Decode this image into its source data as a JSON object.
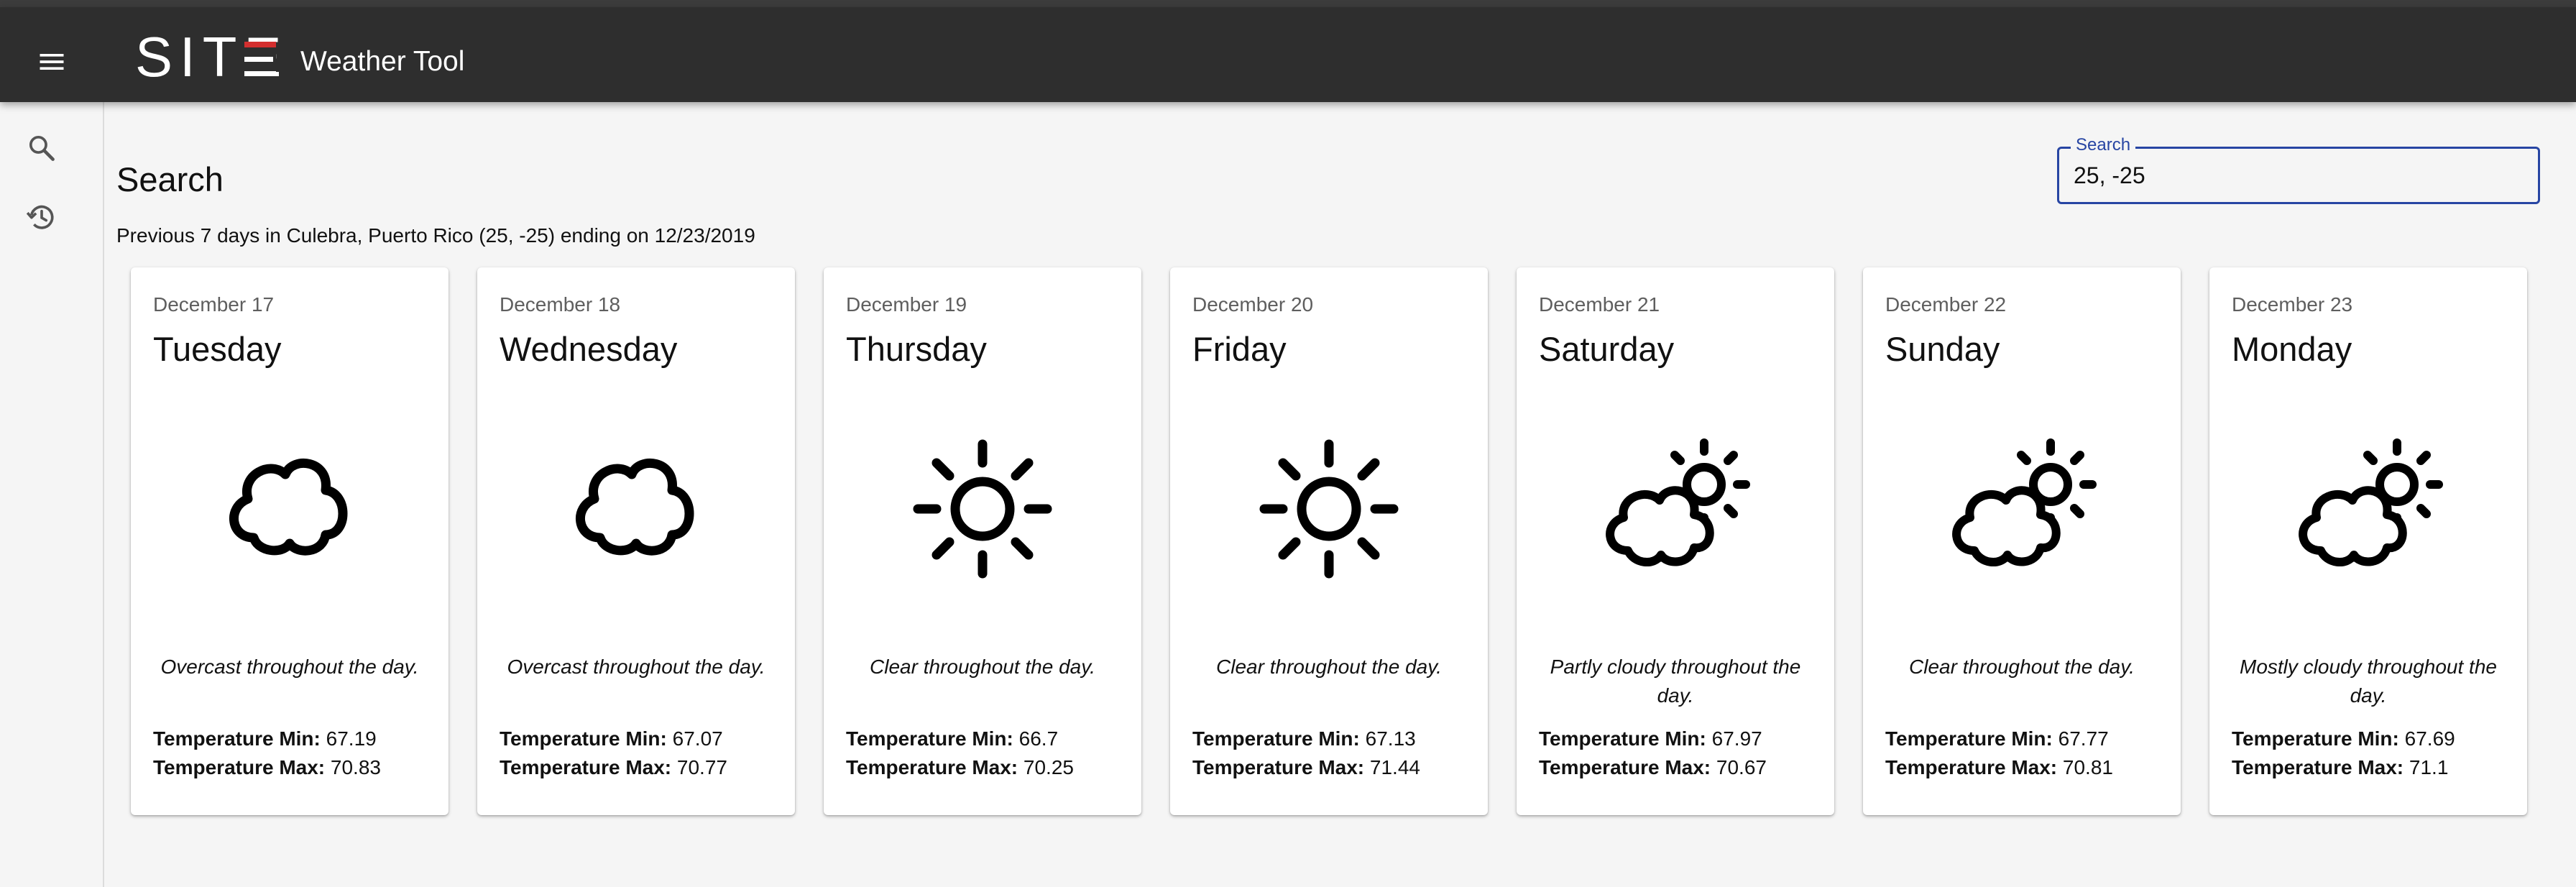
{
  "app": {
    "logo_text": "SITE",
    "title": "Weather Tool"
  },
  "sidebar": {
    "items": [
      {
        "icon": "search-icon"
      },
      {
        "icon": "history-icon"
      }
    ]
  },
  "main": {
    "heading": "Search",
    "subtitle": "Previous 7 days in Culebra, Puerto Rico (25, -25) ending on 12/23/2019"
  },
  "search": {
    "label": "Search",
    "value": "25, -25"
  },
  "temp_labels": {
    "min": "Temperature Min:",
    "max": "Temperature Max:"
  },
  "colors": {
    "appbar": "#2e2e2e",
    "accent": "#2745a3",
    "logo_red": "#d32f2f",
    "background": "#f5f5f5"
  },
  "days": [
    {
      "date": "December 17",
      "weekday": "Tuesday",
      "icon": "cloud-icon",
      "summary": "Overcast throughout the day.",
      "temp_min": "67.19",
      "temp_max": "70.83"
    },
    {
      "date": "December 18",
      "weekday": "Wednesday",
      "icon": "cloud-icon",
      "summary": "Overcast throughout the day.",
      "temp_min": "67.07",
      "temp_max": "70.77"
    },
    {
      "date": "December 19",
      "weekday": "Thursday",
      "icon": "sun-icon",
      "summary": "Clear throughout the day.",
      "temp_min": "66.7",
      "temp_max": "70.25"
    },
    {
      "date": "December 20",
      "weekday": "Friday",
      "icon": "sun-icon",
      "summary": "Clear throughout the day.",
      "temp_min": "67.13",
      "temp_max": "71.44"
    },
    {
      "date": "December 21",
      "weekday": "Saturday",
      "icon": "partly-cloudy-icon",
      "summary": "Partly cloudy throughout the day.",
      "temp_min": "67.97",
      "temp_max": "70.67"
    },
    {
      "date": "December 22",
      "weekday": "Sunday",
      "icon": "partly-cloudy-icon",
      "summary": "Clear throughout the day.",
      "temp_min": "67.77",
      "temp_max": "70.81"
    },
    {
      "date": "December 23",
      "weekday": "Monday",
      "icon": "partly-cloudy-icon",
      "summary": "Mostly cloudy throughout the day.",
      "temp_min": "67.69",
      "temp_max": "71.1"
    }
  ]
}
